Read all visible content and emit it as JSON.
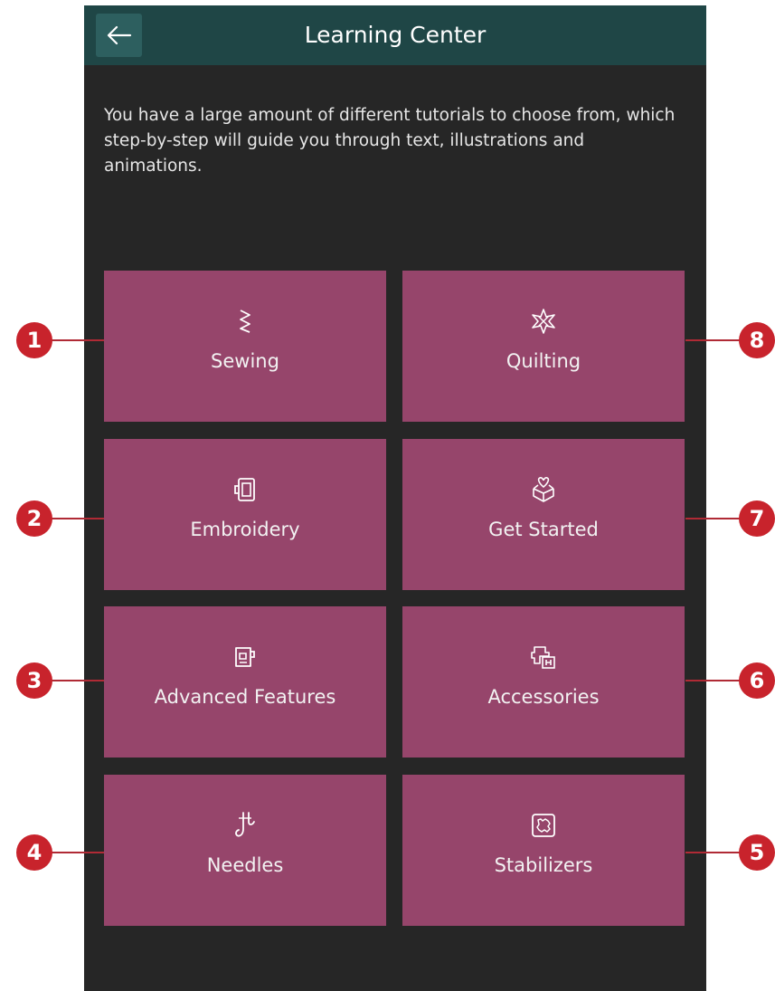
{
  "header": {
    "title": "Learning Center",
    "back_icon": "arrow-left-icon"
  },
  "description": "You have a large amount of different tutorials to choose from, which step-by-step will guide you through text, illustrations and animations.",
  "tiles": [
    {
      "label": "Sewing",
      "icon": "zigzag-stitch-icon",
      "callout": "1"
    },
    {
      "label": "Quilting",
      "icon": "quilt-star-icon",
      "callout": "8"
    },
    {
      "label": "Embroidery",
      "icon": "embroidery-hoop-icon",
      "callout": "2"
    },
    {
      "label": "Get Started",
      "icon": "gift-heart-icon",
      "callout": "7"
    },
    {
      "label": "Advanced Features",
      "icon": "machine-icon",
      "callout": "3"
    },
    {
      "label": "Accessories",
      "icon": "presser-foot-icon",
      "callout": "6"
    },
    {
      "label": "Needles",
      "icon": "needle-icon",
      "callout": "4"
    },
    {
      "label": "Stabilizers",
      "icon": "stabilizer-icon",
      "callout": "5"
    }
  ],
  "colors": {
    "header": "#1f4646",
    "background": "#262626",
    "tile": "#96456b",
    "callout": "#c8232c"
  }
}
